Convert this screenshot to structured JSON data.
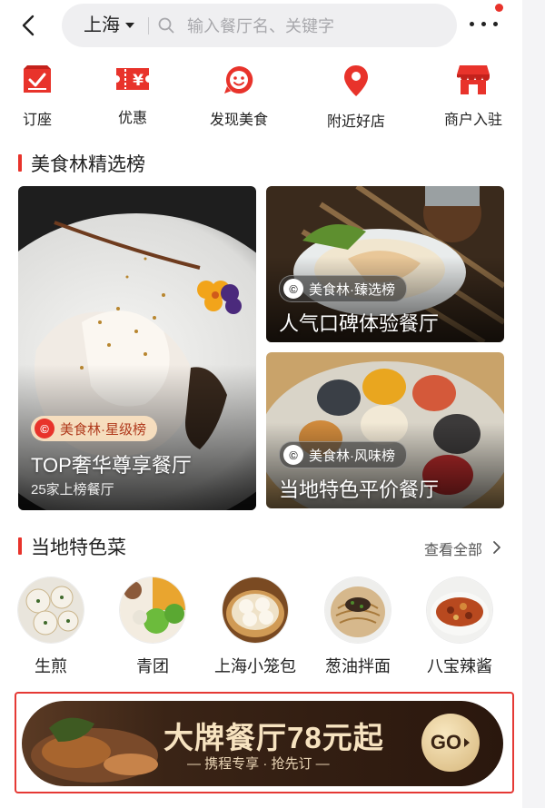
{
  "header": {
    "city": "上海",
    "search_placeholder": "输入餐厅名、关键字"
  },
  "nav": [
    {
      "label": "订座",
      "icon": "calendar-check-icon"
    },
    {
      "label": "优惠",
      "icon": "yuan-ticket-icon"
    },
    {
      "label": "发现美食",
      "icon": "smile-face-icon"
    },
    {
      "label": "附近好店",
      "icon": "location-pin-icon"
    },
    {
      "label": "商户入驻",
      "icon": "storefront-icon"
    }
  ],
  "ranking": {
    "title": "美食林精选榜",
    "cards": [
      {
        "tag": "美食林·星级榜",
        "title": "TOP奢华尊享餐厅",
        "subtitle": "25家上榜餐厅"
      },
      {
        "tag": "美食林·臻选榜",
        "title": "人气口碑体验餐厅"
      },
      {
        "tag": "美食林·风味榜",
        "title": "当地特色平价餐厅"
      }
    ]
  },
  "local": {
    "title": "当地特色菜",
    "view_all": "查看全部",
    "dishes": [
      {
        "name": "生煎"
      },
      {
        "name": "青团"
      },
      {
        "name": "上海小笼包"
      },
      {
        "name": "葱油拌面"
      },
      {
        "name": "八宝辣酱"
      }
    ]
  },
  "banner": {
    "title": "大牌餐厅78元起",
    "subtitle": "— 携程专享 · 抢先订 —",
    "button": "GO"
  },
  "colors": {
    "accent": "#e8332b",
    "banner_gold": "#f7e3c0"
  }
}
